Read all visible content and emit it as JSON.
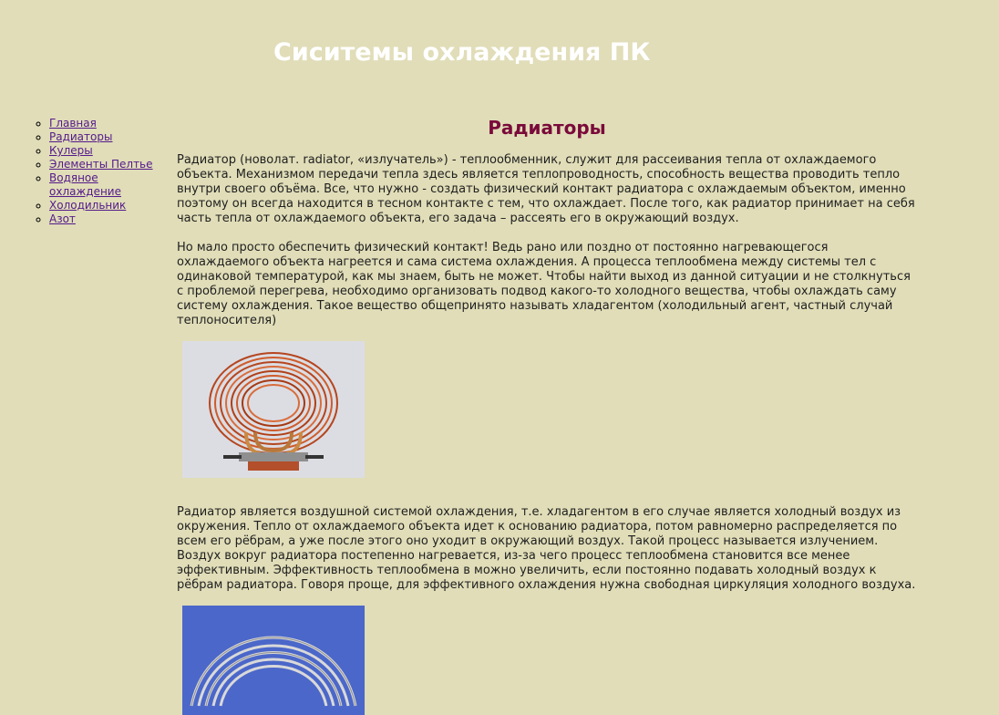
{
  "header": {
    "title": "Сиситемы охлаждения ПК"
  },
  "nav": {
    "items": [
      {
        "label": "Главная"
      },
      {
        "label": "Радиаторы"
      },
      {
        "label": "Кулеры"
      },
      {
        "label": "Элементы Пелтье"
      },
      {
        "label": "Водяное охлаждение"
      },
      {
        "label": "Холодильник"
      },
      {
        "label": "Азот"
      }
    ]
  },
  "main": {
    "heading": "Радиаторы",
    "paragraphs": [
      "Радиатор (новолат. radiator, «излучатель») - теплообменник, служит для рассеивания тепла от охлаждаемого объекта. Механизмом передачи тепла здесь является теплопроводность, способность вещества проводить тепло внутри своего объёма. Все, что нужно - создать физический контакт радиатора с охлаждаемым объектом, именно поэтому он всегда находится в тесном контакте с тем, что охлаждает. После того, как радиатор принимает на себя часть тепла от охлаждаемого объекта, его задача – рассеять его в окружающий воздух.",
      "Но мало просто обеспечить физический контакт! Ведь рано или поздно от постоянно нагревающегося охлаждаемого объекта нагреется и сама система охлаждения. А процесса теплообмена между системы тел с одинаковой температурой, как мы знаем, быть не может. Чтобы найти выход из данной ситуации и не столкнуться с проблемой перегрева, необходимо организовать подвод какого-то холодного вещества, чтобы охлаждать саму систему охлаждения. Такое вещество общепринято называть хладагентом (холодильный агент, частный случай теплоносителя)",
      "Радиатор является воздушной системой охлаждения, т.е. хладагентом в его случае является холодный воздух из окружения. Тепло от охлаждаемого объекта идет к основанию радиатора, потом равномерно распределяется по всем его рёбрам, а уже после этого оно уходит в окружающий воздух. Такой процесс называется излучением. Воздух вокруг радиатора постепенно нагревается, из-за чего процесс теплообмена становится все менее эффективным. Эффективность теплообмена в можно увеличить, если постоянно подавать холодный воздух к рёбрам радиатора. Говоря проще, для эффективного охлаждения нужна свободная циркуляция холодного воздуха."
    ]
  },
  "colors": {
    "background": "#e0ddb8",
    "title": "#ffffff",
    "heading": "#7a0a3a",
    "link": "#551a8b"
  }
}
